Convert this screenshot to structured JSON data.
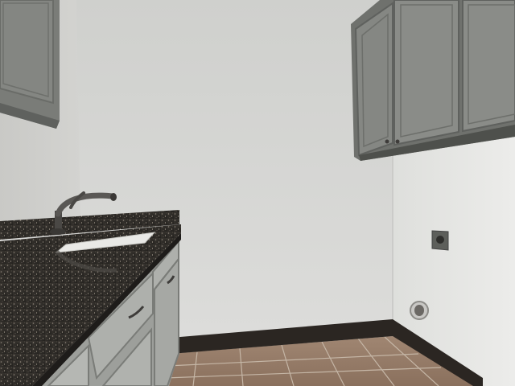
{
  "scene": {
    "subject": "laundry-room",
    "colors": {
      "wall_back": "#d6d6d3",
      "wall_left": "#cfcfcc",
      "wall_right": "#e3e3e1",
      "cabinet": "#7f817d",
      "cabinet_dark": "#5f615e",
      "granite": "#2f2c28",
      "baseboard": "#2b2622",
      "tile": "#9a7f6a"
    }
  }
}
